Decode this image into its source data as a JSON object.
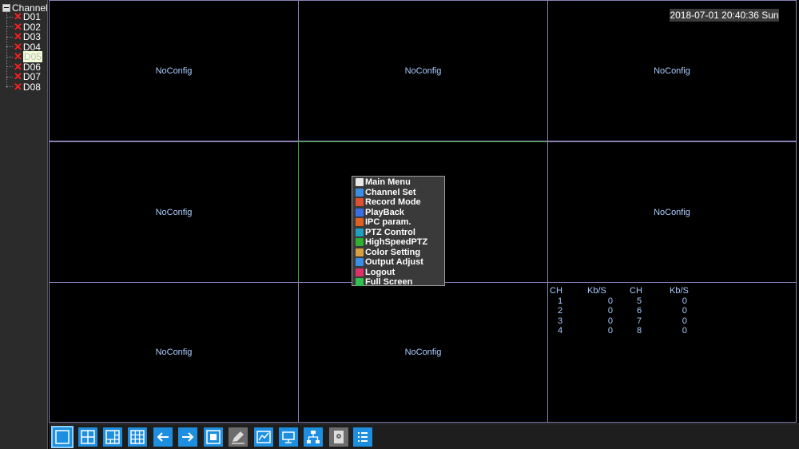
{
  "sidebar": {
    "root_label": "Channel",
    "channels": [
      {
        "label": "D01"
      },
      {
        "label": "D02"
      },
      {
        "label": "D03"
      },
      {
        "label": "D04"
      },
      {
        "label": "D05"
      },
      {
        "label": "D06"
      },
      {
        "label": "D07"
      },
      {
        "label": "D08"
      }
    ]
  },
  "datetime": "2018-07-01 20:40:36 Sun",
  "cells": [
    {
      "text": "NoConfig"
    },
    {
      "text": "NoConfig"
    },
    {
      "text": "NoConfig"
    },
    {
      "text": "NoConfig"
    },
    {
      "text": ""
    },
    {
      "text": "NoConfig"
    },
    {
      "text": "NoConfig"
    },
    {
      "text": "NoConfig"
    },
    {
      "text": ""
    }
  ],
  "stats": {
    "headers": [
      "CH",
      "Kb/S",
      "CH",
      "Kb/S"
    ],
    "rows": [
      [
        "1",
        "0",
        "5",
        "0"
      ],
      [
        "2",
        "0",
        "6",
        "0"
      ],
      [
        "3",
        "0",
        "7",
        "0"
      ],
      [
        "4",
        "0",
        "8",
        "0"
      ]
    ]
  },
  "context_menu": {
    "items": [
      {
        "label": "Main Menu",
        "icon": "home-icon",
        "color": "#e8e8e8"
      },
      {
        "label": "Channel Set",
        "icon": "camera-icon",
        "color": "#3a8ee6"
      },
      {
        "label": "Record Mode",
        "icon": "record-icon",
        "color": "#e05030"
      },
      {
        "label": "PlayBack",
        "icon": "playback-icon",
        "color": "#3a6ee6"
      },
      {
        "label": "IPC param.",
        "icon": "ipc-icon",
        "color": "#e06020"
      },
      {
        "label": "PTZ Control",
        "icon": "ptz-icon",
        "color": "#20a0c0"
      },
      {
        "label": "HighSpeedPTZ",
        "icon": "highspeed-ptz-icon",
        "color": "#30b030"
      },
      {
        "label": "Color Setting",
        "icon": "color-grid-icon",
        "color": "#d8a040"
      },
      {
        "label": "Output Adjust",
        "icon": "output-icon",
        "color": "#3a8ee6"
      },
      {
        "label": "Logout",
        "icon": "power-icon",
        "color": "#e0306a"
      },
      {
        "label": "Full Screen",
        "icon": "fullscreen-icon",
        "color": "#30c050"
      }
    ]
  },
  "toolbar": {
    "buttons": [
      {
        "icon": "layout-1-icon"
      },
      {
        "icon": "layout-4-icon"
      },
      {
        "icon": "layout-6-icon"
      },
      {
        "icon": "layout-9-icon"
      },
      {
        "icon": "arrow-left-icon"
      },
      {
        "icon": "arrow-right-icon"
      },
      {
        "icon": "fullscreen-icon"
      },
      {
        "icon": "edit-icon"
      },
      {
        "icon": "chart-icon"
      },
      {
        "icon": "monitor-icon"
      },
      {
        "icon": "network-icon"
      },
      {
        "icon": "hdd-icon"
      },
      {
        "icon": "list-menu-icon"
      }
    ]
  },
  "colors": {
    "accent": "#1e8fe0",
    "grid_line": "#8a80b4",
    "selected_cell": "#3fa83a",
    "nosignal_text": "#aaccff"
  }
}
